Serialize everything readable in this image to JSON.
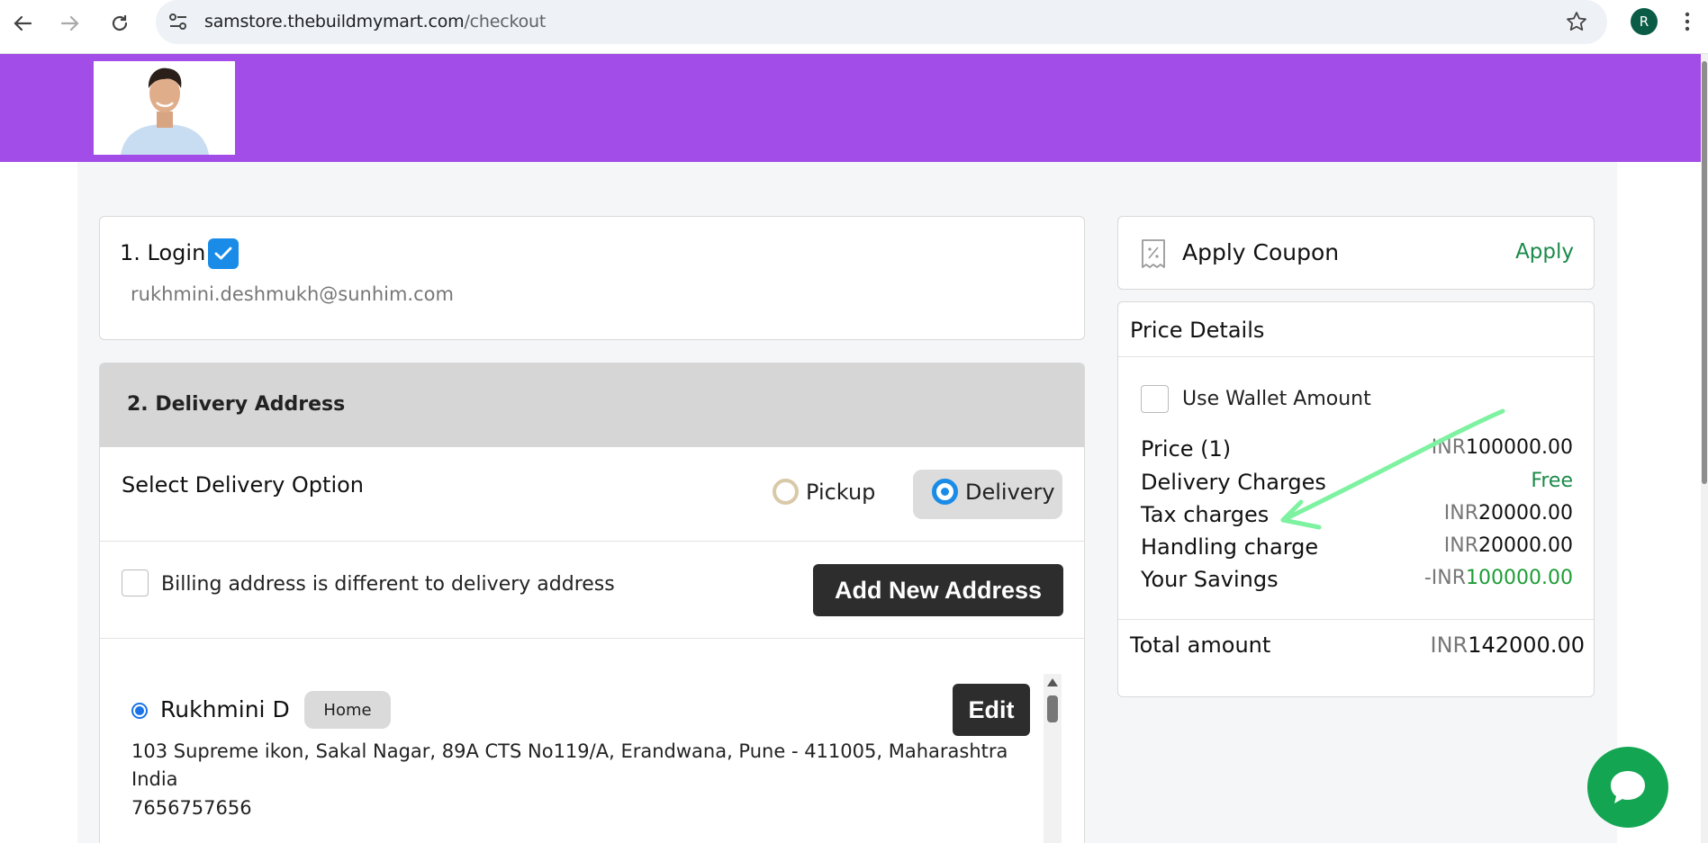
{
  "browser": {
    "url_host": "samstore.thebuildmymart.com",
    "url_path": "/checkout",
    "profile_initial": "R",
    "icons": [
      "back-arrow-icon",
      "forward-arrow-icon",
      "reload-icon",
      "site-info-icon",
      "star-bookmark-icon",
      "menu-dots-icon"
    ]
  },
  "header": {
    "brand_color": "#a24de8",
    "logo": "store-logo-portrait"
  },
  "login": {
    "title": "1. Login",
    "email": "rukhmini.deshmukh@sunhim.com",
    "checked": true
  },
  "delivery": {
    "title": "2. Delivery Address",
    "select_label": "Select Delivery Option",
    "options": [
      {
        "label": "Pickup",
        "selected": false
      },
      {
        "label": "Delivery",
        "selected": true
      }
    ],
    "billing_label": "Billing address is different to delivery address",
    "add_address_label": "Add New Address",
    "address": {
      "name": "Rukhmini D",
      "tag": "Home",
      "edit_label": "Edit",
      "line1": "103 Supreme ikon, Sakal Nagar, 89A CTS No119/A, Erandwana, Pune - 411005, Maharashtra",
      "line2": "India",
      "phone": "7656757656"
    }
  },
  "coupon": {
    "title": "Apply Coupon",
    "apply_label": "Apply"
  },
  "price": {
    "title": "Price Details",
    "wallet_label": "Use Wallet Amount",
    "currency": "INR",
    "rows": [
      {
        "label": "Price (1)",
        "prefix": "",
        "currency": "INR",
        "amount": "100000.00"
      },
      {
        "label": "Delivery Charges",
        "free": "Free"
      },
      {
        "label": "Tax charges",
        "prefix": "",
        "currency": "INR",
        "amount": "20000.00"
      },
      {
        "label": "Handling charge",
        "prefix": "",
        "currency": "INR",
        "amount": "20000.00"
      },
      {
        "label": "Your Savings",
        "prefix": "-",
        "currency": "INR",
        "amount": "100000.00"
      }
    ],
    "total_label": "Total amount",
    "total_currency": "INR",
    "total_amount": "142000.00"
  },
  "colors": {
    "accent_blue": "#1a8ce8",
    "button_dark": "#2d2d2d",
    "green": "#1e9d37",
    "chat_green": "#13a552",
    "annotation": "#7df2a0"
  }
}
